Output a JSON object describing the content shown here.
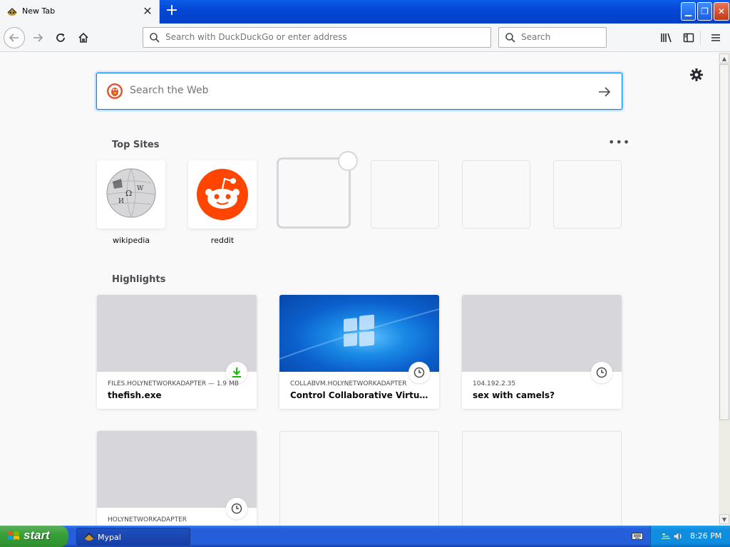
{
  "browser": {
    "tab": {
      "title": "New Tab",
      "close_glyph": "✕"
    },
    "new_tab_glyph": "+",
    "window_buttons": {
      "minimize": "▁",
      "maximize": "❐",
      "close": "✕"
    },
    "urlbar": {
      "placeholder": "Search with DuckDuckGo or enter address"
    },
    "searchbar": {
      "placeholder": "Search"
    }
  },
  "newtab": {
    "websearch": {
      "placeholder": "Search the Web"
    },
    "top_sites_title": "Top Sites",
    "more_glyph": "•••",
    "top_sites": [
      {
        "label": "wikipedia",
        "icon": "wikipedia-icon"
      },
      {
        "label": "reddit",
        "icon": "reddit-icon"
      }
    ],
    "highlights_title": "Highlights",
    "highlights": [
      {
        "host": "FILES.HOLYNETWORKADAPTER — 1.9 MB",
        "title": "thefish.exe",
        "badge": "download-icon"
      },
      {
        "host": "COLLABVM.HOLYNETWORKADAPTER",
        "title": "Control Collaborative Virtual Ma...",
        "badge": "clock-icon"
      },
      {
        "host": "104.192.2.35",
        "title": "sex with camels?",
        "badge": "clock-icon"
      },
      {
        "host": "HOLYNETWORKADAPTER",
        "title": "",
        "badge": "clock-icon"
      }
    ]
  },
  "taskbar": {
    "start_label": "start",
    "task_label": "Mypal",
    "clock": "8:26 PM"
  },
  "colors": {
    "accent": "#0a84ff",
    "reddit": "#ff4500",
    "download_green": "#12bc00",
    "xp_blue": "#245edb",
    "xp_green": "#37a137"
  }
}
